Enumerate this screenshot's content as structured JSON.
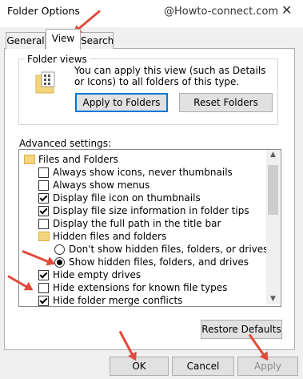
{
  "window": {
    "title": "Folder Options",
    "watermark": "@Howto-connect.com",
    "close_glyph": "✕"
  },
  "tabs": [
    {
      "label": "General"
    },
    {
      "label": "View",
      "active": true
    },
    {
      "label": "Search"
    }
  ],
  "folder_views": {
    "legend": "Folder views",
    "description": "You can apply this view (such as Details or Icons) to all folders of this type.",
    "apply_button": "Apply to Folders",
    "reset_button": "Reset Folders",
    "icon": "folder-grid-icon"
  },
  "advanced": {
    "label": "Advanced settings:",
    "items": [
      {
        "type": "folder",
        "label": "Files and Folders"
      },
      {
        "type": "checkbox",
        "label": "Always show icons, never thumbnails",
        "checked": false
      },
      {
        "type": "checkbox",
        "label": "Always show menus",
        "checked": false
      },
      {
        "type": "checkbox",
        "label": "Display file icon on thumbnails",
        "checked": true
      },
      {
        "type": "checkbox",
        "label": "Display file size information in folder tips",
        "checked": true
      },
      {
        "type": "checkbox",
        "label": "Display the full path in the title bar",
        "checked": false
      },
      {
        "type": "folder",
        "label": "Hidden files and folders"
      },
      {
        "type": "radio",
        "label": "Don't show hidden files, folders, or drives",
        "checked": false
      },
      {
        "type": "radio",
        "label": "Show hidden files, folders, and drives",
        "checked": true
      },
      {
        "type": "checkbox",
        "label": "Hide empty drives",
        "checked": true
      },
      {
        "type": "checkbox",
        "label": "Hide extensions for known file types",
        "checked": false
      },
      {
        "type": "checkbox",
        "label": "Hide folder merge conflicts",
        "checked": true
      }
    ]
  },
  "buttons": {
    "restore": "Restore Defaults",
    "ok": "OK",
    "cancel": "Cancel",
    "apply": "Apply"
  },
  "colors": {
    "annotation_arrow": "#e04a3a",
    "focus_border": "#0078d7"
  }
}
